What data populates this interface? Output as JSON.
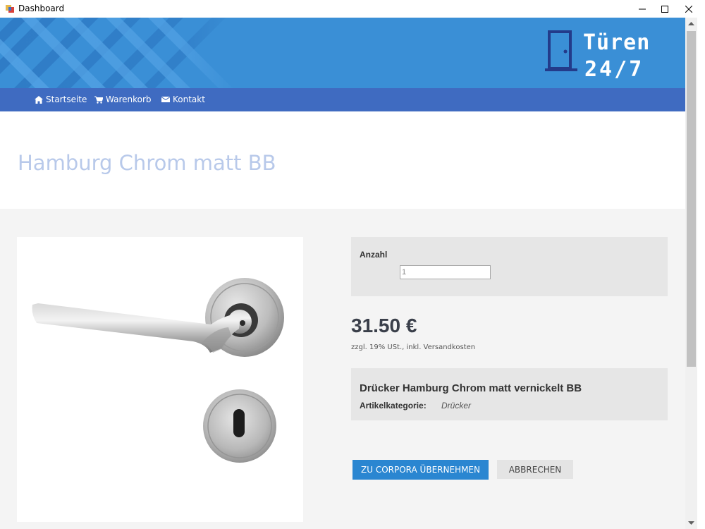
{
  "window": {
    "title": "Dashboard",
    "minimize_icon": "minimize-icon",
    "maximize_icon": "maximize-icon",
    "close_icon": "close-icon"
  },
  "brand": {
    "line1": "Türen",
    "line2": "24/7",
    "icon": "door-icon",
    "banner_color": "#3a8fd6",
    "nav_color": "#3f6bc1"
  },
  "nav": {
    "items": [
      {
        "label": "Startseite",
        "icon": "home-icon"
      },
      {
        "label": "Warenkorb",
        "icon": "cart-icon"
      },
      {
        "label": "Kontakt",
        "icon": "envelope-icon"
      }
    ]
  },
  "page": {
    "title": "Hamburg Chrom matt BB"
  },
  "product": {
    "image": "door-handle-image",
    "quantity_label": "Anzahl",
    "quantity_value": "1",
    "price": "31.50 €",
    "price_note": "zzgl. 19% USt., inkl. Versandkosten",
    "name": "Drücker Hamburg Chrom matt vernickelt BB",
    "category_label": "Artikelkategorie:",
    "category_value": "Drücker"
  },
  "actions": {
    "primary_label": "ZU CORPORA ÜBERNEHMEN",
    "primary_color": "#2a86d1",
    "secondary_label": "ABBRECHEN"
  }
}
